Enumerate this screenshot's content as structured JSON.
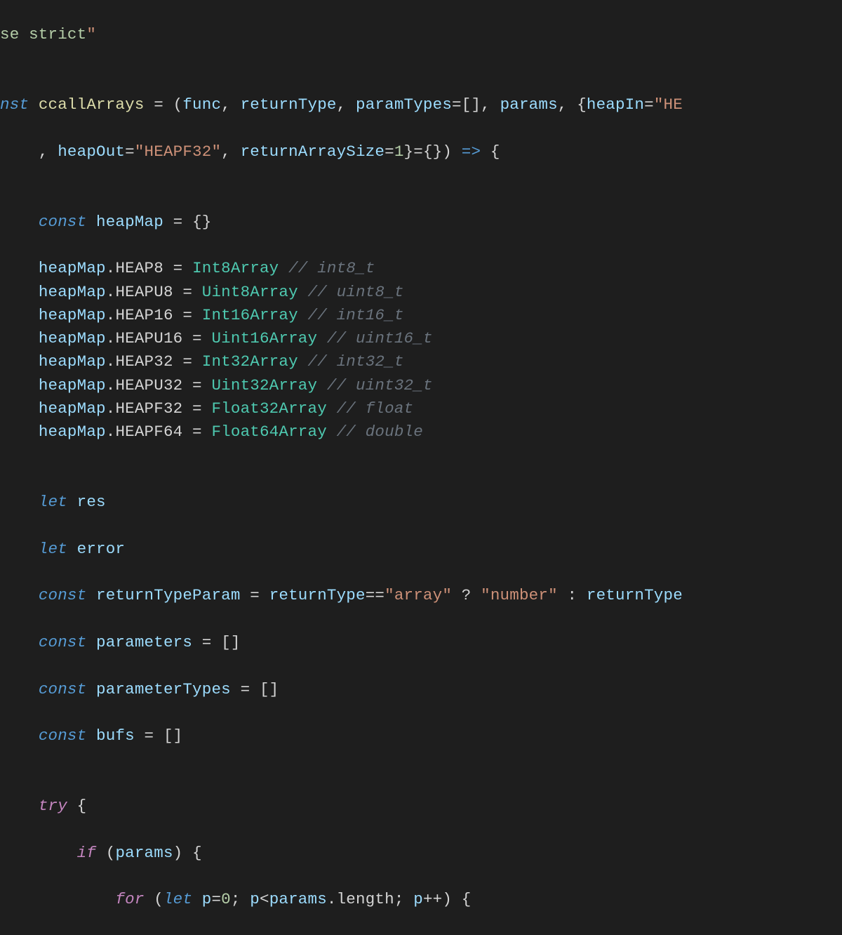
{
  "line1": {
    "frag1": "se strict",
    "frag2": "\""
  },
  "line2_blank": "",
  "line3": {
    "frag_nst": "nst",
    "sp1": " ",
    "fn_name": "ccallArrays",
    "sp2": " ",
    "eq": "=",
    "sp3": " ",
    "lp": "(",
    "p_func": "func",
    "c1": ",",
    "sp4": " ",
    "p_returnType": "returnType",
    "c2": ",",
    "sp5": " ",
    "p_paramTypes": "paramTypes",
    "eq2": "=[]",
    "c3": ",",
    "sp6": " ",
    "p_params": "params",
    "c4": ",",
    "sp7": " ",
    "lbrace": "{",
    "p_heapIn": "heapIn",
    "eq3": "=",
    "str_q1": "\"",
    "str_he": "HE"
  },
  "line4": {
    "indent": "    ",
    "c1": ",",
    "sp1": " ",
    "p_heapOut": "heapOut",
    "eq1": "=",
    "str_heapf32": "\"HEAPF32\"",
    "c2": ",",
    "sp2": " ",
    "p_returnArraySize": "returnArraySize",
    "eq2": "=",
    "num1": "1",
    "rbrace": "}",
    "eq3": "=",
    "emptyobj": "{}",
    "rp": ")",
    "sp3": " ",
    "arrow": "=>",
    "sp4": " ",
    "lbrace2": "{"
  },
  "line_blank2": "",
  "line_hm1": {
    "indent": "    ",
    "kw_const": "const",
    "sp1": " ",
    "name": "heapMap",
    "sp2": " ",
    "eq": "=",
    "sp3": " ",
    "obj": "{}"
  },
  "heap_lines": [
    {
      "obj": "heapMap",
      "dot": ".",
      "prop": "HEAP8",
      "sp_eq": " = ",
      "type": "Int8Array",
      "comment": "// int8_t"
    },
    {
      "obj": "heapMap",
      "dot": ".",
      "prop": "HEAPU8",
      "sp_eq": " = ",
      "type": "Uint8Array",
      "comment": "// uint8_t"
    },
    {
      "obj": "heapMap",
      "dot": ".",
      "prop": "HEAP16",
      "sp_eq": " = ",
      "type": "Int16Array",
      "comment": "// int16_t"
    },
    {
      "obj": "heapMap",
      "dot": ".",
      "prop": "HEAPU16",
      "sp_eq": " = ",
      "type": "Uint16Array",
      "comment": "// uint16_t"
    },
    {
      "obj": "heapMap",
      "dot": ".",
      "prop": "HEAP32",
      "sp_eq": " = ",
      "type": "Int32Array",
      "comment": "// int32_t"
    },
    {
      "obj": "heapMap",
      "dot": ".",
      "prop": "HEAPU32",
      "sp_eq": " = ",
      "type": "Uint32Array",
      "comment": "// uint32_t"
    },
    {
      "obj": "heapMap",
      "dot": ".",
      "prop": "HEAPF32",
      "sp_eq": " = ",
      "type": "Float32Array",
      "comment": "// float"
    },
    {
      "obj": "heapMap",
      "dot": ".",
      "prop": "HEAPF64",
      "sp_eq": " = ",
      "type": "Float64Array",
      "comment": "// double"
    }
  ],
  "line_blank3": "",
  "let_res": {
    "indent": "    ",
    "kw": "let",
    "sp": " ",
    "name": "res"
  },
  "let_error": {
    "indent": "    ",
    "kw": "let",
    "sp": " ",
    "name": "error"
  },
  "const_rtp": {
    "indent": "    ",
    "kw": "const",
    "sp1": " ",
    "name": "returnTypeParam",
    "sp2": " ",
    "eq": "=",
    "sp3": " ",
    "rhs_var": "returnType",
    "eqeq": "==",
    "str_array": "\"array\"",
    "sp4": " ",
    "qmark": "?",
    "sp5": " ",
    "str_number": "\"number\"",
    "sp6": " ",
    "colon": ":",
    "sp7": " ",
    "rhs_var2": "returnType"
  },
  "const_parameters": {
    "indent": "    ",
    "kw": "const",
    "sp1": " ",
    "name": "parameters",
    "sp2": " ",
    "eq": "=",
    "sp3": " ",
    "arr": "[]"
  },
  "const_parameterTypes": {
    "indent": "    ",
    "kw": "const",
    "sp1": " ",
    "name": "parameterTypes",
    "sp2": " ",
    "eq": "=",
    "sp3": " ",
    "arr": "[]"
  },
  "const_bufs": {
    "indent": "    ",
    "kw": "const",
    "sp1": " ",
    "name": "bufs",
    "sp2": " ",
    "eq": "=",
    "sp3": " ",
    "arr": "[]"
  },
  "line_blank4": "",
  "try_line": {
    "indent": "    ",
    "kw": "try",
    "sp": " ",
    "brace": "{"
  },
  "if_line": {
    "indent": "        ",
    "kw": "if",
    "sp1": " ",
    "lp": "(",
    "var": "params",
    "rp": ")",
    "sp2": " ",
    "brace": "{"
  },
  "for_line": {
    "indent": "            ",
    "kw_for": "for",
    "sp1": " ",
    "lp": "(",
    "kw_let": "let",
    "sp2": " ",
    "var_p": "p",
    "eq": "=",
    "num0": "0",
    "semi1": ";",
    "sp3": " ",
    "var_p2": "p",
    "lt": "<",
    "params": "params",
    "dot": ".",
    "length": "length",
    "semi2": ";",
    "sp4": " ",
    "var_p3": "p",
    "inc": "++",
    "rp": ")",
    "sp5": " ",
    "brace": "{"
  }
}
